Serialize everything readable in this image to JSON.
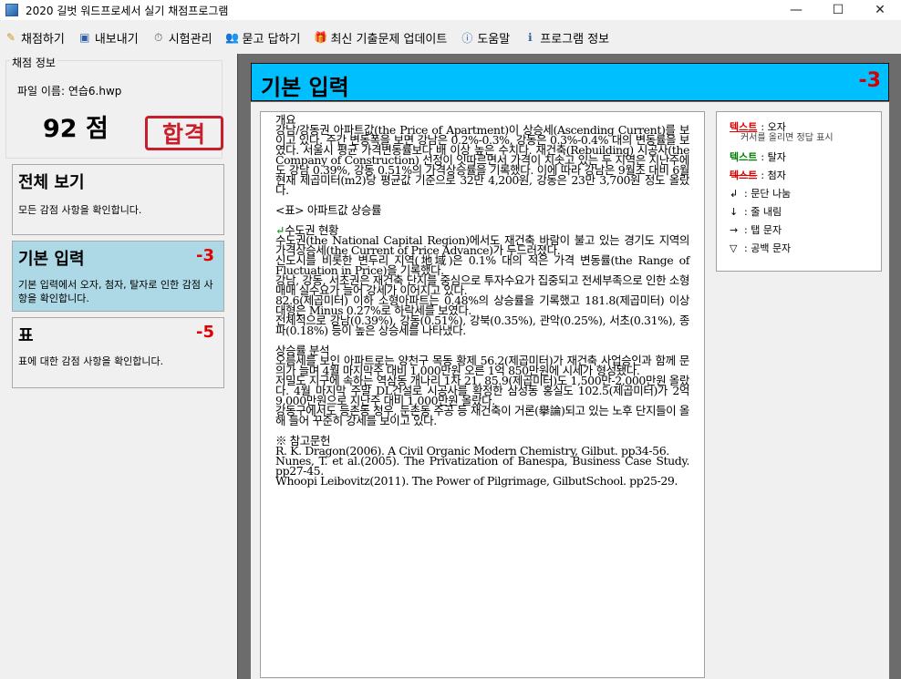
{
  "window": {
    "title": "2020 길벗 워드프로세서 실기 채점프로그램"
  },
  "menu": [
    {
      "label": "채점하기",
      "icon": "pencil-icon"
    },
    {
      "label": "내보내기",
      "icon": "save-icon"
    },
    {
      "label": "시험관리",
      "icon": "stopwatch-icon"
    },
    {
      "label": "묻고 답하기",
      "icon": "people-icon"
    },
    {
      "label": "최신 기출문제 업데이트",
      "icon": "gift-icon"
    },
    {
      "label": "도움말",
      "icon": "help-icon"
    },
    {
      "label": "프로그램 정보",
      "icon": "info-icon"
    }
  ],
  "score": {
    "legend": "채점 정보",
    "filename": "파일 이름: 연습6.hwp",
    "score_text": "92 점",
    "stamp": "합격"
  },
  "cards": [
    {
      "title": "전체 보기",
      "deduct": "",
      "desc": "모든 감점 사항을 확인합니다."
    },
    {
      "title": "기본 입력",
      "deduct": "-3",
      "desc": "기본 입력에서 오자, 첨자, 탈자로 인한 감점 사항을 확인합니다."
    },
    {
      "title": "표",
      "deduct": "-5",
      "desc": "표에 대한 감점 사항을 확인합니다."
    }
  ],
  "header": {
    "title": "기본 입력",
    "deduct": "-3"
  },
  "document": {
    "p1": "개요",
    "p2": "강남/강동권 아파트값(the Price of Apartment)이 상승세(Ascending Current)를 보이고 있다. 주간 변동폭을 보면 강남은 0.2%-0.3%, 강동은 0.3%-0.4% 대의 변동률을 보였다. 서울시 평균 가격변동률보다 배 이상 높은 수치다. 재건축(Rebuilding) 시공사(the Company of Construction) 선정이 잇따르면서 가격이 치솟고 있는 두 지역은 지난주에도 강남 0.39%, 강동 0.51%의 가격상승률을 기록했다. 이에 따라 강남은 9월초 대비 6월 현재 제곱미터(m2)당 평균값 기준으로 32만 4,200원, 강동은 23만 3,700원 정도 올랐다.",
    "p3": "<표> 아파트값 상승률",
    "p4_mark": "↵",
    "p4": "수도권 현황",
    "p5": "수도권(the National Capital Region)에서도 재건축 바람이 불고 있는 경기도 지역의 가격상승세(the Current of Price Advance)가 두드러졌다.",
    "p6": "신도시를 비롯한 변두리 지역(地域)은 0.1% 대의 적은 가격 변동률(the Range of Fluctuation in Price)을 기록했다.",
    "p7": "강남, 강동, 서초권은 재건축 단지를 중심으로 투자수요가 집중되고 전세부족으로 인한 소형 매매 실수요가 늘어 강세가 이어지고 있다.",
    "p8": "82.6(제곱미터) 이하 소형아파트는 0.48%의 상승률을 기록했고 181.8(제곱미터) 이상 대형은 Minus 0.27%로 하락세를 보였다.",
    "p9": "전체적으로 강남(0.39%), 강동(0.51%), 강북(0.35%), 관악(0.25%), 서초(0.31%), 종파(0.18%) 등이 높은 상승세를 나타냈다.",
    "p10": "상승률 분석",
    "p11": "오름세를 보인 아파트로는 양천구 목동 황제 56.2(제곱미터)가 재건축 사업승인과 함께 문의가 늘며 4월 마지막주 대비 1,000만원 오른 1억 850만원에 시세가 형성됐다.",
    "p12": "저밀도 지구에 속하는 역삼동 개나리 1차 21, 85.9(제곱미터)도 1,500만-2,000만원 올랐다. 4월 마지막 주말 DL건설로 시공사를 확정한 삼성동 홍실도 102.5(제곱미터)가 2억 9,000만원으로 지난주 대비 1,000만원 올랐다.",
    "p13": "강동구에서도 등촌동 청우, 둔촌동 주공 등 재건축이 거론(擧論)되고 있는 노후 단지들이 올해 들어 꾸준히 강세를 보이고 있다.",
    "p14": "※ 참고문헌",
    "p15": "R. K. Dragon(2006). A Civil Organic Modern Chemistry, Gilbut. pp34-56.",
    "p16": "Nunes, T. et al.(2005). The Privatization of Banespa, Business Case Study. pp27-45.",
    "p17": "Whoopi Leibovitz(2011). The Power of Pilgrimage, GilbutSchool. pp25-29."
  },
  "legend": {
    "r1_text": "텍스트",
    "r1_label": ": 오자",
    "hint": "커서를 올리면 정답 표시",
    "r2_text": "텍스트",
    "r2_label": ": 탈자",
    "r3_text": "텍스트",
    "r3_label": ": 첨자",
    "r4_sym": "↲",
    "r4_label": ": 문단 나눔",
    "r5_sym": "↓",
    "r5_label": ": 줄 내림",
    "r6_sym": "→",
    "r6_label": ": 탭 문자",
    "r7_sym": "▽",
    "r7_label": ": 공백 문자"
  },
  "colors": {
    "header_bg": "#00bfff",
    "active_card": "#add8e6",
    "deduct_red": "#e00000"
  }
}
